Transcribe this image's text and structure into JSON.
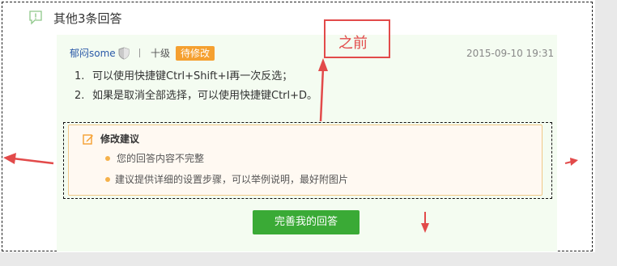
{
  "header": {
    "title": "其他3条回答",
    "icon": "comment-exclamation-icon"
  },
  "answer": {
    "user_name": "郁闷some",
    "user_icon": "shield-icon",
    "level": "十级",
    "badge": "待修改",
    "timestamp": "2015-09-10 19:31",
    "lines": [
      {
        "num": "1.",
        "text": "可以使用快捷键Ctrl+Shift+I再一次反选；"
      },
      {
        "num": "2.",
        "text": "如果是取消全部选择，可以使用快捷键Ctrl+D。"
      }
    ]
  },
  "suggestion": {
    "title": "修改建议",
    "icon": "edit-icon",
    "items": [
      "您的回答内容不完整",
      "建议提供详细的设置步骤，可以举例说明，最好附图片"
    ]
  },
  "action": {
    "button_label": "完善我的回答"
  },
  "annotation": {
    "label": "之前"
  },
  "colors": {
    "accent_green": "#3aaa36",
    "badge_orange": "#f5a030",
    "annotation_red": "#e24a4a",
    "card_bg": "#f4fcf1",
    "suggest_bg": "#fff9f2",
    "link_blue": "#2a59a8"
  }
}
